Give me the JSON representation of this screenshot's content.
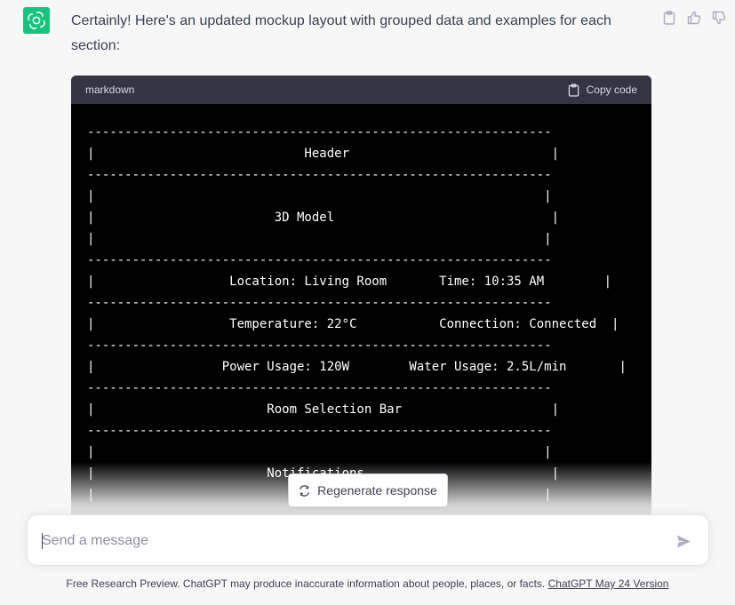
{
  "message": {
    "text": "Certainly! Here's an updated mockup layout with grouped data and examples for each section:"
  },
  "code_block": {
    "language": "markdown",
    "copy_label": "Copy code",
    "lines": [
      "--------------------------------------------------------------",
      "|                            Header                           |",
      "--------------------------------------------------------------",
      "|                                                            |",
      "|                        3D Model                             |",
      "|                                                            |",
      "--------------------------------------------------------------",
      "|                  Location: Living Room       Time: 10:35 AM        |",
      "--------------------------------------------------------------",
      "|                  Temperature: 22°C           Connection: Connected  |",
      "--------------------------------------------------------------",
      "|                 Power Usage: 120W        Water Usage: 2.5L/min       |",
      "--------------------------------------------------------------",
      "|                       Room Selection Bar                    |",
      "--------------------------------------------------------------",
      "|                                                            |",
      "|                       Notifications                         |",
      "|                                                            |",
      "--------------------------------------------------------------"
    ]
  },
  "regenerate": {
    "label": "Regenerate response"
  },
  "composer": {
    "placeholder": "Send a message"
  },
  "footer": {
    "text": "Free Research Preview. ChatGPT may produce inaccurate information about people, places, or facts.",
    "link": "ChatGPT May 24 Version"
  },
  "colors": {
    "brand": "#19c37d",
    "code_bg": "#000000",
    "code_header": "#343541"
  },
  "icons": [
    "openai-logo-icon",
    "clipboard-icon",
    "thumbs-up-icon",
    "thumbs-down-icon",
    "refresh-icon",
    "send-icon"
  ]
}
